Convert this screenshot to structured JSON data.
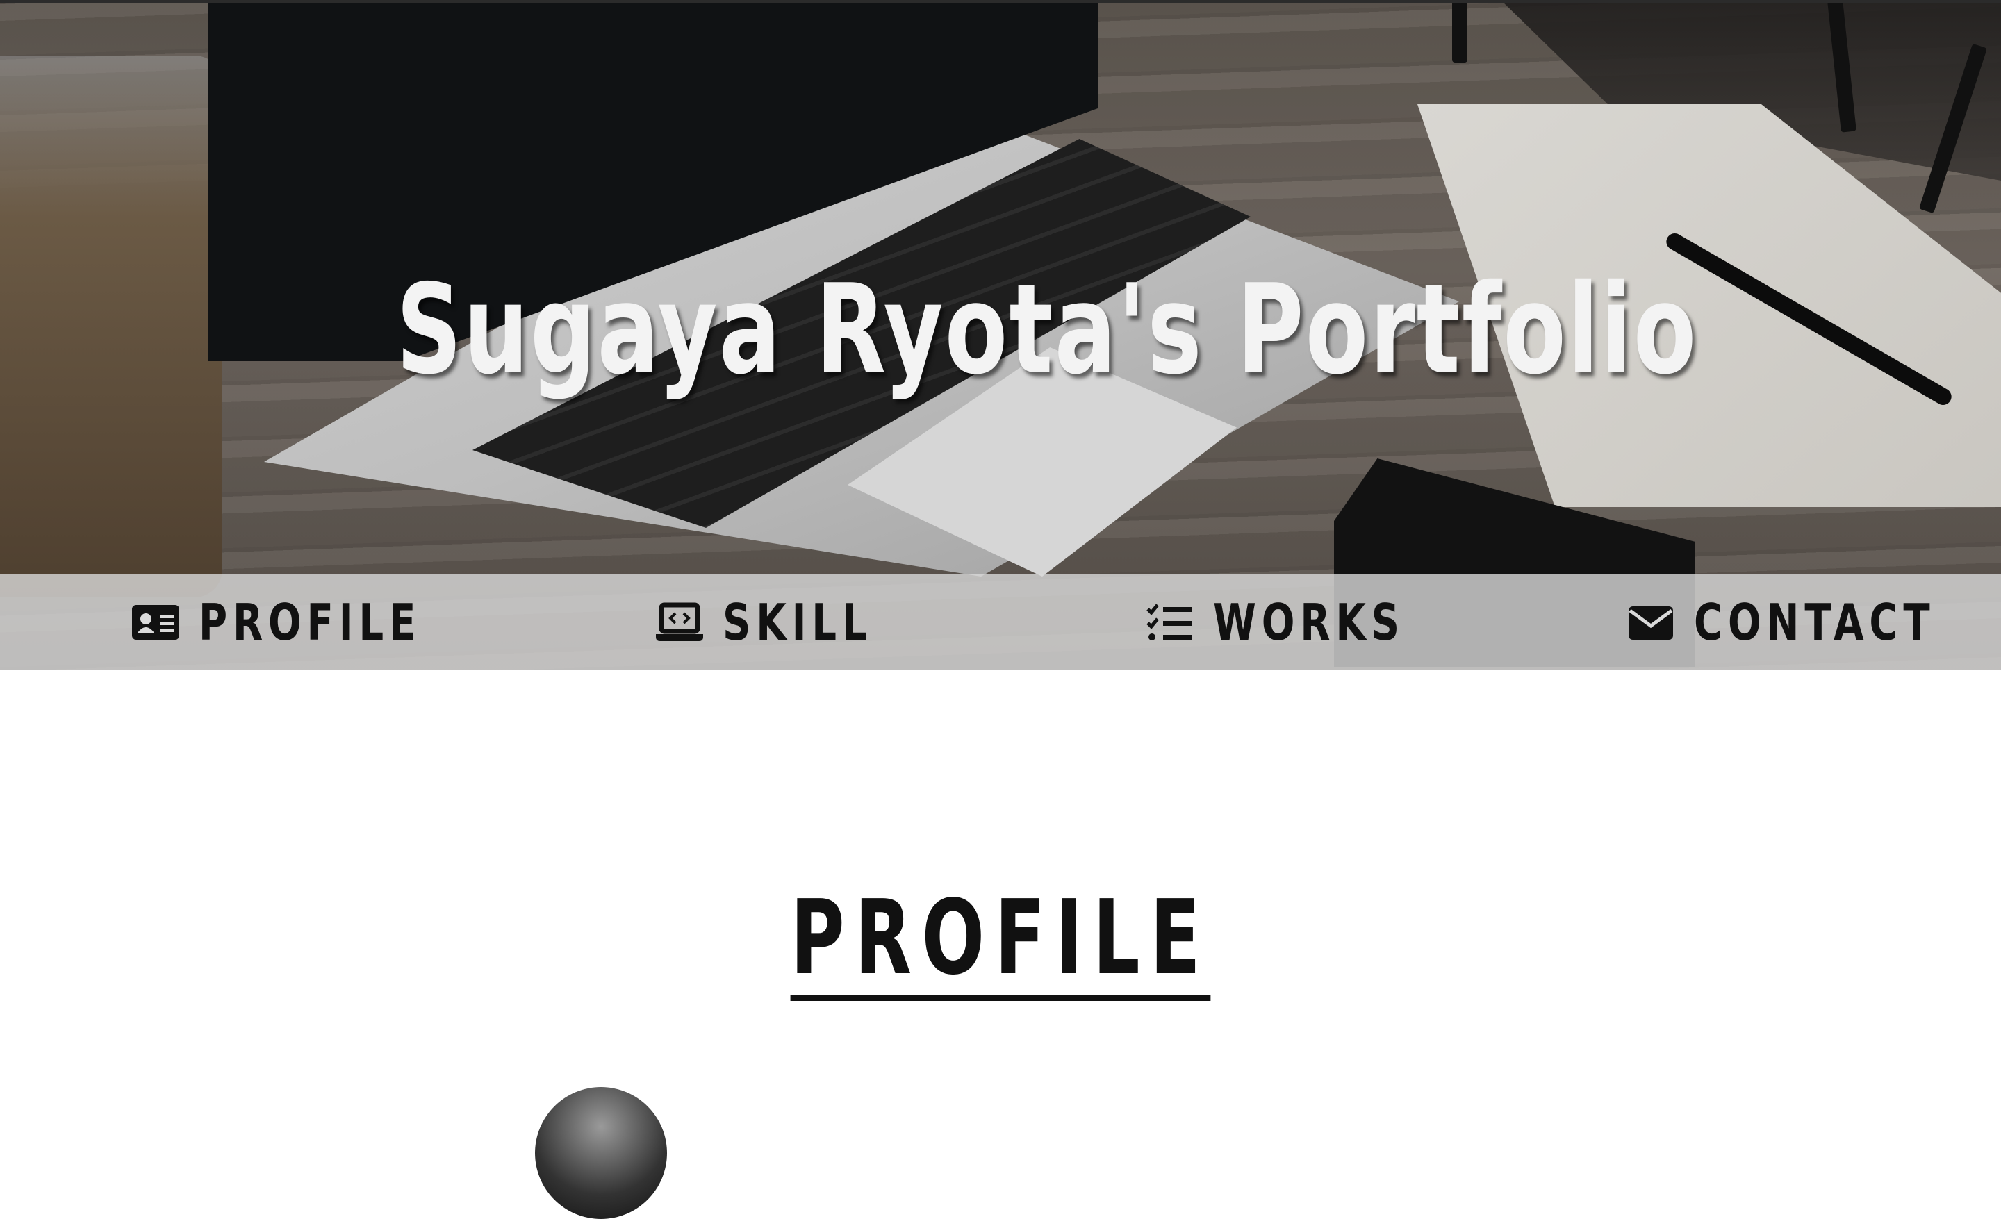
{
  "hero": {
    "title": "Sugaya Ryota's Portfolio"
  },
  "nav": {
    "items": [
      {
        "label": "PROFILE",
        "icon": "id-card-icon"
      },
      {
        "label": "SKILL",
        "icon": "laptop-code-icon"
      },
      {
        "label": "WORKS",
        "icon": "task-list-icon"
      },
      {
        "label": "CONTACT",
        "icon": "envelope-icon"
      }
    ]
  },
  "profile": {
    "heading": "PROFILE"
  },
  "colors": {
    "nav_bar": "#dadada",
    "text_dark": "#111111",
    "hero_text": "#f3f3f3"
  }
}
